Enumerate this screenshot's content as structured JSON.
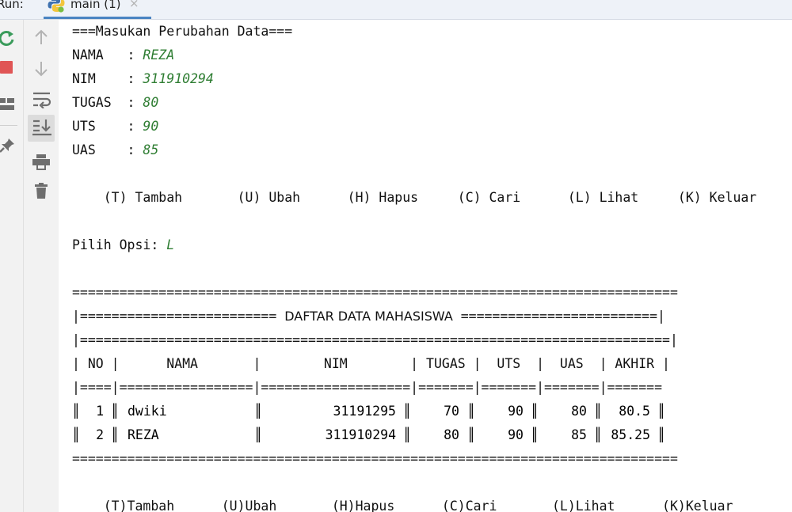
{
  "topbar": {
    "run_label": "Run:",
    "tab": {
      "title": "main (1)",
      "close_glyph": "×",
      "icon": "python-icon"
    }
  },
  "toolbar_left": [
    "rerun-icon",
    "stop-icon",
    "layout-icon",
    "pin-icon"
  ],
  "toolbar_right": [
    "scroll-up-icon",
    "scroll-down-icon",
    "soft-wrap-icon",
    "scroll-to-end-icon",
    "print-icon",
    "trash-icon"
  ],
  "console": {
    "heading": "===Masukan Perubahan Data===",
    "fields": [
      {
        "label": "NAMA   : ",
        "value": "REZA"
      },
      {
        "label": "NIM    : ",
        "value": "311910294"
      },
      {
        "label": "TUGAS  : ",
        "value": "80"
      },
      {
        "label": "UTS    : ",
        "value": "90"
      },
      {
        "label": "UAS    : ",
        "value": "85"
      }
    ],
    "menu1": "    (T) Tambah       (U) Ubah      (H) Hapus     (C) Cari      (L) Lihat     (K) Keluar",
    "prompt_label": "Pilih Opsi: ",
    "prompt_value": "L",
    "rule_top": "=============================================================================",
    "title_left": "|========================= ",
    "title_text": "DAFTAR DATA MAHASISWA",
    "title_right": " =========================|",
    "rule_inner": "|===========================================================================|",
    "columns": [
      "NO",
      "NAMA",
      "NIM",
      "TUGAS",
      "UTS",
      "UAS",
      "AKHIR"
    ],
    "header_line": "| NO |      NAMA       |        NIM        | TUGAS |  UTS  |  UAS  | AKHIR |",
    "header_rule": "|====|=================|===================|=======|=======|=======|=======",
    "rows": [
      {
        "no": "1",
        "nama": "dwiki",
        "nim": "31191295",
        "tugas": "70",
        "uts": "90",
        "uas": "80",
        "akhir": "80.5"
      },
      {
        "no": "2",
        "nama": "REZA",
        "nim": "311910294",
        "tugas": "80",
        "uts": "90",
        "uas": "85",
        "akhir": "85.25"
      }
    ],
    "rule_bottom": "=============================================================================",
    "menu2": "    (T)Tambah      (U)Ubah       (H)Hapus      (C)Cari       (L)Lihat      (K)Keluar"
  }
}
